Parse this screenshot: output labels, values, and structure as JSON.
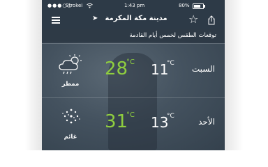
{
  "status_bar": {
    "signal": "●●●○○",
    "carrier": "Strokei",
    "time": "1:43 pm",
    "battery": "80%"
  },
  "nav": {
    "location": "مدينة مكة المكرمة",
    "menu_icon": "hamburger-menu-icon",
    "favorite_icon": "star-icon",
    "share_icon": "share-icon"
  },
  "forecast_title": "توقعات الطقس لخمس أيام القادمة",
  "days": [
    {
      "day": "السبت",
      "condition": "ممطر",
      "condition_icon": "rain-cloud-icon",
      "high": "28",
      "low": "11",
      "deg": "°C"
    },
    {
      "day": "الأحد",
      "condition": "غائم",
      "condition_icon": "snow-cloud-icon",
      "high": "31",
      "low": "13",
      "deg": "°C"
    }
  ],
  "colors": {
    "high_temp": "#8fce3f",
    "nav_bg": "#2d3a47"
  }
}
